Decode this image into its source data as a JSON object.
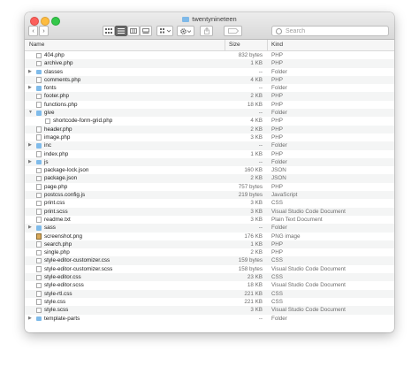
{
  "window": {
    "title": "twentynineteen"
  },
  "toolbar": {
    "back_label": "‹",
    "forward_label": "›",
    "search_placeholder": "Search"
  },
  "columns": {
    "name": "Name",
    "size": "Size",
    "kind": "Kind"
  },
  "files": [
    {
      "name": "404.php",
      "size": "832 bytes",
      "kind": "PHP",
      "type": "file",
      "depth": 0
    },
    {
      "name": "archive.php",
      "size": "1 KB",
      "kind": "PHP",
      "type": "file",
      "depth": 0
    },
    {
      "name": "classes",
      "size": "--",
      "kind": "Folder",
      "type": "folder",
      "depth": 0,
      "expanded": false
    },
    {
      "name": "comments.php",
      "size": "4 KB",
      "kind": "PHP",
      "type": "file",
      "depth": 0
    },
    {
      "name": "fonts",
      "size": "--",
      "kind": "Folder",
      "type": "folder",
      "depth": 0,
      "expanded": false
    },
    {
      "name": "footer.php",
      "size": "2 KB",
      "kind": "PHP",
      "type": "file",
      "depth": 0
    },
    {
      "name": "functions.php",
      "size": "18 KB",
      "kind": "PHP",
      "type": "file",
      "depth": 0
    },
    {
      "name": "give",
      "size": "--",
      "kind": "Folder",
      "type": "folder",
      "depth": 0,
      "expanded": true
    },
    {
      "name": "shortcode-form-grid.php",
      "size": "4 KB",
      "kind": "PHP",
      "type": "file",
      "depth": 1
    },
    {
      "name": "header.php",
      "size": "2 KB",
      "kind": "PHP",
      "type": "file",
      "depth": 0
    },
    {
      "name": "image.php",
      "size": "3 KB",
      "kind": "PHP",
      "type": "file",
      "depth": 0
    },
    {
      "name": "inc",
      "size": "--",
      "kind": "Folder",
      "type": "folder",
      "depth": 0,
      "expanded": false
    },
    {
      "name": "index.php",
      "size": "1 KB",
      "kind": "PHP",
      "type": "file",
      "depth": 0
    },
    {
      "name": "js",
      "size": "--",
      "kind": "Folder",
      "type": "folder",
      "depth": 0,
      "expanded": false
    },
    {
      "name": "package-lock.json",
      "size": "160 KB",
      "kind": "JSON",
      "type": "file",
      "depth": 0
    },
    {
      "name": "package.json",
      "size": "2 KB",
      "kind": "JSON",
      "type": "file",
      "depth": 0
    },
    {
      "name": "page.php",
      "size": "757 bytes",
      "kind": "PHP",
      "type": "file",
      "depth": 0
    },
    {
      "name": "postcss.config.js",
      "size": "219 bytes",
      "kind": "JavaScript",
      "type": "file",
      "depth": 0
    },
    {
      "name": "print.css",
      "size": "3 KB",
      "kind": "CSS",
      "type": "file",
      "depth": 0
    },
    {
      "name": "print.scss",
      "size": "3 KB",
      "kind": "Visual Studio Code Document",
      "type": "file",
      "depth": 0
    },
    {
      "name": "readme.txt",
      "size": "3 KB",
      "kind": "Plain Text Document",
      "type": "file",
      "depth": 0
    },
    {
      "name": "sass",
      "size": "--",
      "kind": "Folder",
      "type": "folder",
      "depth": 0,
      "expanded": false
    },
    {
      "name": "screenshot.png",
      "size": "176 KB",
      "kind": "PNG image",
      "type": "image",
      "depth": 0
    },
    {
      "name": "search.php",
      "size": "1 KB",
      "kind": "PHP",
      "type": "file",
      "depth": 0
    },
    {
      "name": "single.php",
      "size": "2 KB",
      "kind": "PHP",
      "type": "file",
      "depth": 0
    },
    {
      "name": "style-editor-customizer.css",
      "size": "159 bytes",
      "kind": "CSS",
      "type": "file",
      "depth": 0
    },
    {
      "name": "style-editor-customizer.scss",
      "size": "158 bytes",
      "kind": "Visual Studio Code Document",
      "type": "file",
      "depth": 0
    },
    {
      "name": "style-editor.css",
      "size": "23 KB",
      "kind": "CSS",
      "type": "file",
      "depth": 0
    },
    {
      "name": "style-editor.scss",
      "size": "18 KB",
      "kind": "Visual Studio Code Document",
      "type": "file",
      "depth": 0
    },
    {
      "name": "style-rtl.css",
      "size": "221 KB",
      "kind": "CSS",
      "type": "file",
      "depth": 0
    },
    {
      "name": "style.css",
      "size": "221 KB",
      "kind": "CSS",
      "type": "file",
      "depth": 0
    },
    {
      "name": "style.scss",
      "size": "3 KB",
      "kind": "Visual Studio Code Document",
      "type": "file",
      "depth": 0
    },
    {
      "name": "template-parts",
      "size": "--",
      "kind": "Folder",
      "type": "folder",
      "depth": 0,
      "expanded": false
    }
  ]
}
